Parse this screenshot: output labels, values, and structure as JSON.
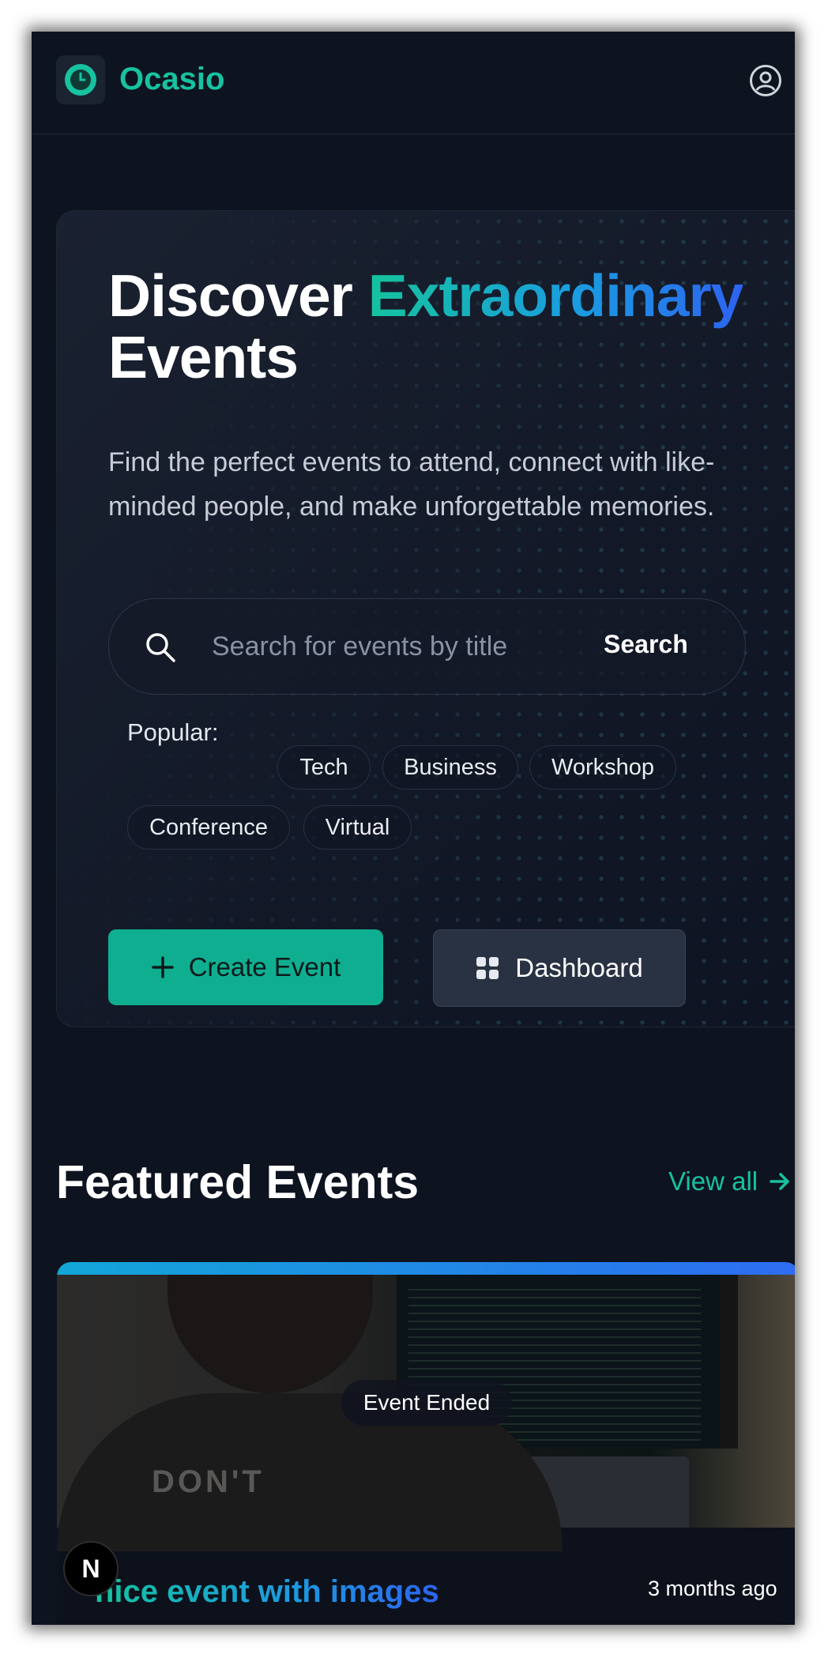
{
  "header": {
    "brand": "Ocasio",
    "logo_icon": "clock-icon",
    "profile_icon": "user-circle-icon"
  },
  "hero": {
    "title_part1": "Discover ",
    "title_highlight": "Extraordinary",
    "title_part2": "Events",
    "subtitle": "Find the perfect events to attend, connect with like-minded people, and make unforgettable memories.",
    "search": {
      "placeholder": "Search for events by title",
      "value": "",
      "button_label": "Search"
    },
    "popular_label": "Popular:",
    "popular_tags": [
      "Tech",
      "Business",
      "Workshop",
      "Conference",
      "Virtual"
    ],
    "create_button": "Create Event",
    "dashboard_button": "Dashboard"
  },
  "featured": {
    "title": "Featured Events",
    "view_all": "View all",
    "events": [
      {
        "status": "Event Ended",
        "title": "nice event with images",
        "time_ago": "3 months ago",
        "image_text": "DON'T"
      }
    ]
  },
  "dev_badge": "N",
  "colors": {
    "background": "#0e1320",
    "accent": "#17c2a0",
    "accent_blue": "#2d63f0",
    "create_button": "#0fae91",
    "dashboard_button": "#293242"
  }
}
